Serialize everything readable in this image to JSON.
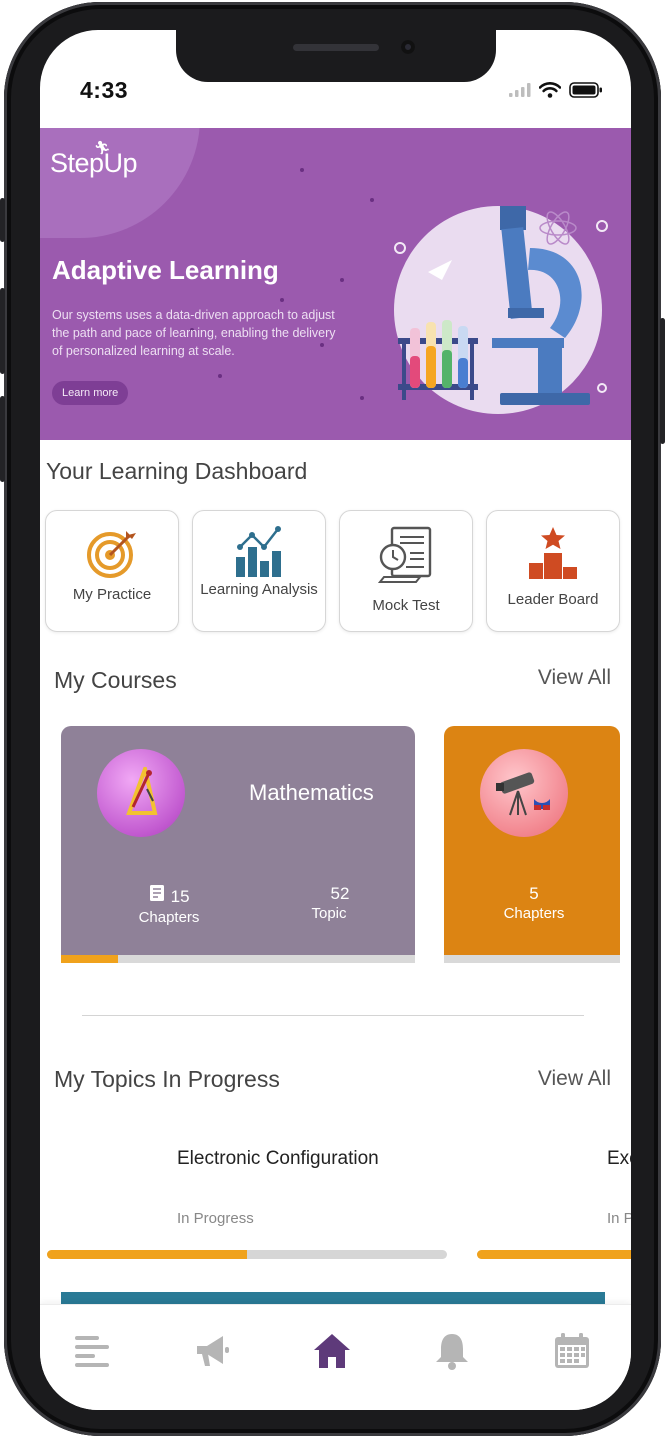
{
  "status_bar": {
    "time": "4:33"
  },
  "banner": {
    "logo": "StepUp",
    "title": "Adaptive Learning",
    "text": "Our systems uses a data-driven approach to adjust the path and pace of learning, enabling the delivery of personalized learning at scale.",
    "button": "Learn more"
  },
  "dashboard": {
    "title": "Your Learning Dashboard",
    "cards": [
      {
        "label": "My Practice",
        "icon": "target-icon"
      },
      {
        "label": "Learning Analysis",
        "icon": "bar-chart-icon"
      },
      {
        "label": "Mock Test",
        "icon": "clock-document-icon"
      },
      {
        "label": "Leader Board",
        "icon": "podium-star-icon"
      }
    ]
  },
  "courses": {
    "title": "My Courses",
    "view_all": "View All",
    "items": [
      {
        "name": "Mathematics",
        "chapters_count": "15",
        "chapters_label": "Chapters",
        "topic_count": "52",
        "topic_label": "Topic",
        "progress": 0.16,
        "color": "#8f8198",
        "icon": "geometry-tools-icon"
      },
      {
        "name": "",
        "chapters_count": "5",
        "chapters_label": "Chapters",
        "progress": 0.0,
        "color": "#dc8413",
        "icon": "telescope-magnet-icon"
      }
    ]
  },
  "topics": {
    "title": "My Topics In Progress",
    "view_all": "View All",
    "items": [
      {
        "name": "Electronic Configuration",
        "status": "In Progress",
        "progress": 0.5
      },
      {
        "name": "Exc",
        "status": "In P",
        "progress": 0.5
      }
    ]
  },
  "bottom_nav": {
    "items": [
      "menu-icon",
      "megaphone-icon",
      "home-icon",
      "bell-icon",
      "calendar-icon"
    ],
    "active": "home-icon"
  },
  "colors": {
    "brand": "#9b5aae",
    "accent": "#f0a21c",
    "nav_active": "#5e3a7a",
    "nav_inactive": "#b5b5b5"
  }
}
